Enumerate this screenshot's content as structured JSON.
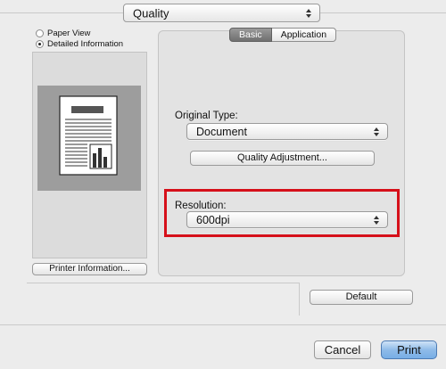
{
  "settings_menu": {
    "selected": "Quality"
  },
  "view_options": {
    "paper_view": "Paper View",
    "detailed_information": "Detailed Information",
    "selected": "detailed_information"
  },
  "printer_information_label": "Printer Information...",
  "tabs": [
    {
      "label": "Basic",
      "selected": true
    },
    {
      "label": "Application",
      "selected": false
    }
  ],
  "original_type": {
    "label": "Original Type:",
    "value": "Document"
  },
  "quality_adjustment_label": "Quality Adjustment...",
  "resolution": {
    "label": "Resolution:",
    "value": "600dpi"
  },
  "default_label": "Default",
  "cancel_label": "Cancel",
  "print_label": "Print",
  "colors": {
    "highlight": "#d6101a",
    "print_button": "#8fbbe8"
  }
}
